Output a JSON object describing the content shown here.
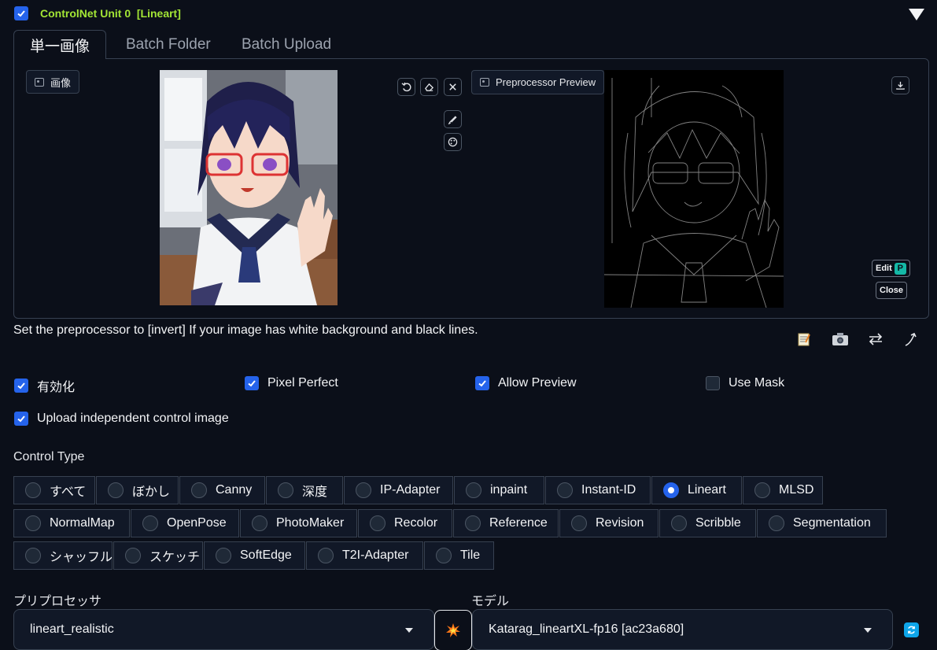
{
  "header": {
    "enabled": true,
    "title": "ControlNet Unit 0  [Lineart]"
  },
  "tabs": [
    {
      "label": "単一画像",
      "active": true
    },
    {
      "label": "Batch Folder",
      "active": false
    },
    {
      "label": "Batch Upload",
      "active": false
    }
  ],
  "image_panel": {
    "input_label": "画像",
    "input_image": "anime-schoolgirl-photo",
    "preview_label": "Preprocessor Preview",
    "preview_image": "lineart-preview",
    "edit_label": "Edit",
    "close_label": "Close"
  },
  "hint": "Set the preprocessor to [invert] If your image has white background and black lines.",
  "options": {
    "enable_label": "有効化",
    "enable": true,
    "pixel_perfect_label": "Pixel Perfect",
    "pixel_perfect": true,
    "allow_preview_label": "Allow Preview",
    "allow_preview": true,
    "use_mask_label": "Use Mask",
    "use_mask": false,
    "upload_independent_label": "Upload independent control image",
    "upload_independent": true
  },
  "control_type": {
    "label": "Control Type",
    "selected": "Lineart",
    "rows": [
      [
        "すべて",
        "ぼかし",
        "Canny",
        "深度",
        "IP-Adapter",
        "inpaint",
        "Instant-ID",
        "Lineart",
        "MLSD"
      ],
      [
        "NormalMap",
        "OpenPose",
        "PhotoMaker",
        "Recolor",
        "Reference",
        "Revision",
        "Scribble",
        "Segmentation"
      ],
      [
        "シャッフル",
        "スケッチ",
        "SoftEdge",
        "T2I-Adapter",
        "Tile"
      ]
    ]
  },
  "preprocessor": {
    "label": "プリプロセッサ",
    "value": "lineart_realistic"
  },
  "model": {
    "label": "モデル",
    "value": "Katarag_lineartXL-fp16 [ac23a680]"
  },
  "colors": {
    "title_green": "#a3e635",
    "accent_blue": "#2563eb",
    "background": "#0b0f19"
  }
}
